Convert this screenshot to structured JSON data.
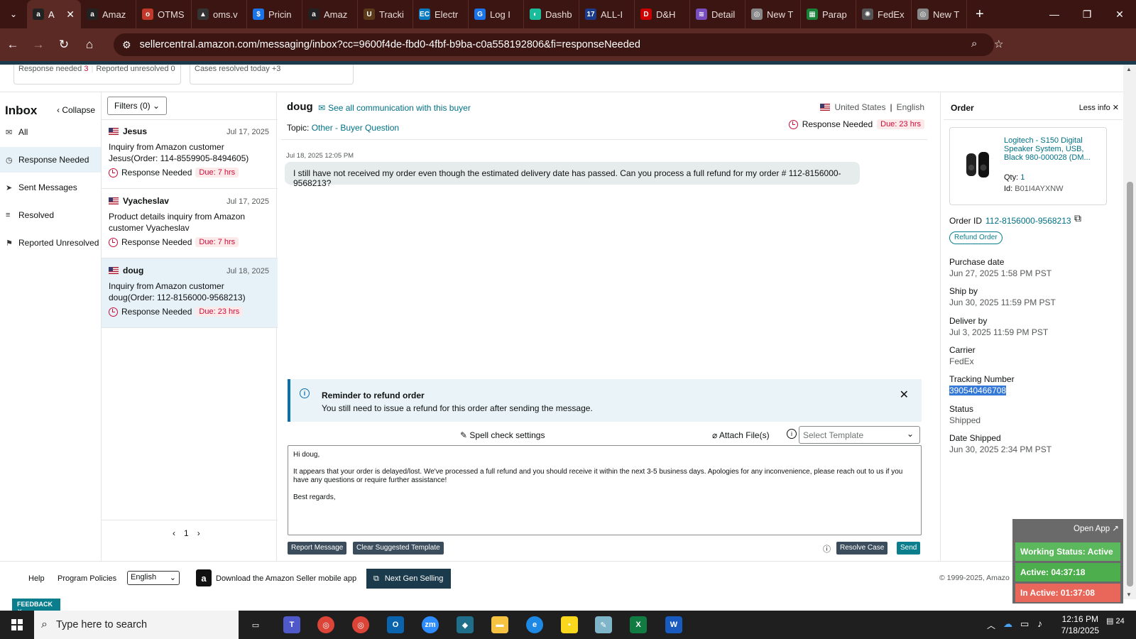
{
  "browser": {
    "tabs": [
      {
        "label": "A",
        "icon": "amazon-icon",
        "active": true
      },
      {
        "label": "Amaz",
        "icon": "amazon-icon"
      },
      {
        "label": "OTMS",
        "icon": "otms-icon"
      },
      {
        "label": "oms.v",
        "icon": "oms-icon"
      },
      {
        "label": "Pricin",
        "icon": "pricing-icon"
      },
      {
        "label": "Amaz",
        "icon": "amazon-icon"
      },
      {
        "label": "Tracki",
        "icon": "ups-icon"
      },
      {
        "label": "Electr",
        "icon": "ec-icon"
      },
      {
        "label": "Log I",
        "icon": "g-icon"
      },
      {
        "label": "Dashb",
        "icon": "dash-icon"
      },
      {
        "label": "ALL-I",
        "icon": "17-icon"
      },
      {
        "label": "D&H",
        "icon": "dh-icon"
      },
      {
        "label": "Detail",
        "icon": "detail-icon"
      },
      {
        "label": "New T",
        "icon": "chrome-icon"
      },
      {
        "label": "Parap",
        "icon": "sheets-icon"
      },
      {
        "label": "FedEx",
        "icon": "openai-icon"
      },
      {
        "label": "New T",
        "icon": "chrome-icon"
      }
    ],
    "url": "sellercentral.amazon.com/messaging/inbox?cc=9600f4de-fbd0-4fbf-b9ba-c0a558192806&fi=responseNeeded"
  },
  "stats": {
    "response_needed_label": "Response needed",
    "response_needed_count": "3",
    "reported_unresolved_label": "Reported unresolved",
    "reported_unresolved_count": "0",
    "cases_resolved_label": "Cases resolved today",
    "cases_resolved_count": "+3"
  },
  "nav": {
    "title": "Inbox",
    "collapse": "Collapse",
    "items": [
      {
        "label": "All",
        "icon": "mail-icon"
      },
      {
        "label": "Response Needed",
        "icon": "clock-icon",
        "selected": true
      },
      {
        "label": "Sent Messages",
        "icon": "send-icon"
      },
      {
        "label": "Resolved",
        "icon": "check-list-icon"
      },
      {
        "label": "Reported Unresolved",
        "icon": "person-flag-icon"
      }
    ]
  },
  "list": {
    "filters": "Filters (0)",
    "messages": [
      {
        "name": "Jesus",
        "date": "Jul 17, 2025",
        "subject": "Inquiry from Amazon customer Jesus(Order: 114-8559905-8494605)",
        "status": "Response Needed",
        "due": "Due: 7 hrs"
      },
      {
        "name": "Vyacheslav",
        "date": "Jul 17, 2025",
        "subject": "Product details inquiry from Amazon customer Vyacheslav",
        "status": "Response Needed",
        "due": "Due: 7 hrs"
      },
      {
        "name": "doug",
        "date": "Jul 18, 2025",
        "subject": "Inquiry from Amazon customer doug(Order: 112-8156000-9568213)",
        "status": "Response Needed",
        "due": "Due: 23 hrs",
        "selected": true
      }
    ],
    "page": "1"
  },
  "conversation": {
    "buyer": "doug",
    "see_all": "See all communication with this buyer",
    "country": "United States",
    "language": "English",
    "topic_label": "Topic:",
    "topic": "Other - Buyer Question",
    "response_needed": "Response Needed",
    "due": "Due: 23 hrs",
    "timestamp": "Jul 18, 2025 12:05 PM",
    "message": "I still have not received my order even though the estimated delivery date has passed. Can you process a full refund for my order # 112-8156000-9568213?",
    "reminder_title": "Reminder to refund order",
    "reminder_body": "You still need to issue a refund for this order after sending the message.",
    "spell_check": "Spell check settings",
    "attach": "Attach File(s)",
    "template_placeholder": "Select Template",
    "reply": {
      "greeting": "Hi doug,",
      "body": "It appears that your order is delayed/lost. We've processed a full refund and you should receive it within the next 3-5 business days. Apologies for any inconvenience, please reach out to us if you have any questions or require further assistance!",
      "closing": "Best regards,"
    },
    "buttons": {
      "report": "Report Message",
      "clear": "Clear Suggested Template",
      "resolve": "Resolve Case",
      "send": "Send"
    }
  },
  "order": {
    "title": "Order",
    "less_info": "Less info",
    "product_title": "Logitech - S150 Digital Speaker System, USB, Black 980-000028 (DM...",
    "qty_label": "Qty:",
    "qty": "1",
    "id_label": "Id:",
    "asin": "B01I4AYXNW",
    "order_id_label": "Order ID",
    "order_id": "112-8156000-9568213",
    "refund_button": "Refund Order",
    "fields": [
      {
        "label": "Purchase date",
        "value": "Jun 27, 2025 1:58 PM PST"
      },
      {
        "label": "Ship by",
        "value": "Jun 30, 2025 11:59 PM PST"
      },
      {
        "label": "Deliver by",
        "value": "Jul 3, 2025 11:59 PM PST"
      },
      {
        "label": "Carrier",
        "value": "FedEx"
      },
      {
        "label": "Tracking Number",
        "value": "390540466708"
      },
      {
        "label": "Status",
        "value": "Shipped"
      },
      {
        "label": "Date Shipped",
        "value": "Jun 30, 2025 2:34 PM PST"
      }
    ]
  },
  "footer": {
    "help": "Help",
    "policies": "Program Policies",
    "language": "English",
    "app": "Download the Amazon Seller mobile app",
    "next_gen": "Next Gen Selling",
    "copyright": "© 1999-2025, Amazo",
    "feedback": "FEEDBACK"
  },
  "widget": {
    "open_app": "Open App ↗",
    "working": "Working Status: Active",
    "active": "Active: 04:37:18",
    "inactive": "In Active: 01:37:08",
    "colors": {
      "working": "#5cb85c",
      "active": "#4cae4c",
      "inactive": "#e8675a"
    }
  },
  "taskbar": {
    "search_placeholder": "Type here to search",
    "time": "12:16 PM",
    "date": "7/18/2025",
    "notifications": "24"
  }
}
